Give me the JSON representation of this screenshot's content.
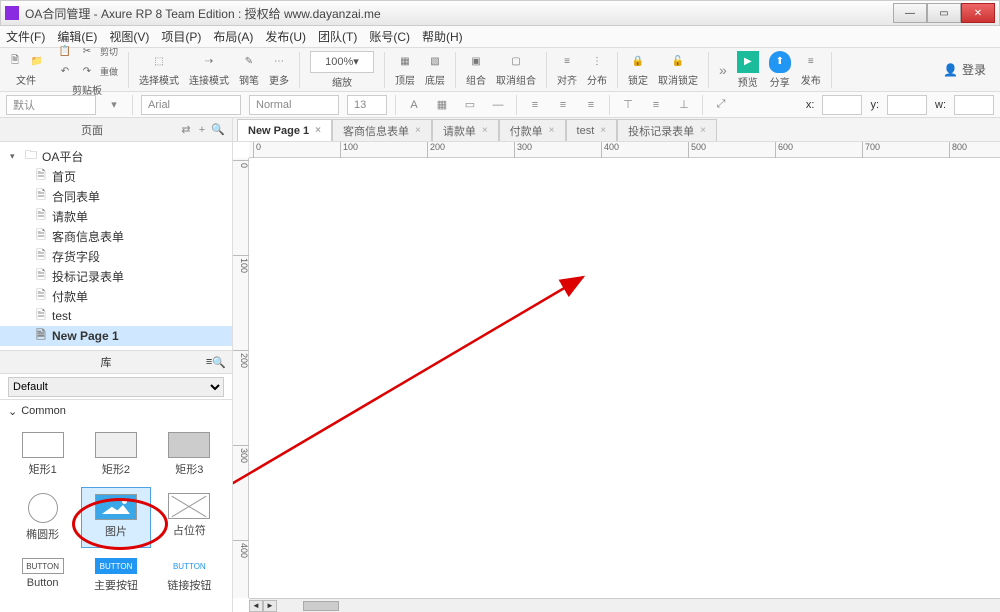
{
  "window": {
    "title": "OA合同管理 - Axure RP 8 Team Edition : 授权给 www.dayanzai.me"
  },
  "menus": [
    "文件(F)",
    "编辑(E)",
    "视图(V)",
    "项目(P)",
    "布局(A)",
    "发布(U)",
    "团队(T)",
    "账号(C)",
    "帮助(H)"
  ],
  "toolbar": {
    "file": "文件",
    "clipboard": "剪贴板",
    "cut": "剪切",
    "redo": "重做",
    "selmode": "选择模式",
    "conmode": "连接模式",
    "pen": "钢笔",
    "more": "更多",
    "zoom": "100%",
    "indent": "缩放",
    "top": "顶层",
    "bottom": "底层",
    "group": "组合",
    "ungroup": "取消组合",
    "align": "对齐",
    "dist": "分布",
    "lock": "锁定",
    "unlock": "取消锁定",
    "preview": "预览",
    "share": "分享",
    "publish": "发布",
    "login": "登录"
  },
  "stylebar": {
    "defaultStyle": "默认",
    "font": "Arial",
    "weight": "Normal",
    "size": "13",
    "xlabel": "x:",
    "ylabel": "y:",
    "wlabel": "w:"
  },
  "pagesPanel": {
    "title": "页面"
  },
  "tree": {
    "root": "OA平台",
    "items": [
      {
        "label": "首页"
      },
      {
        "label": "合同表单"
      },
      {
        "label": "请款单"
      },
      {
        "label": "客商信息表单"
      },
      {
        "label": "存货字段"
      },
      {
        "label": "投标记录表单"
      },
      {
        "label": "付款单"
      },
      {
        "label": "test"
      },
      {
        "label": "New Page 1",
        "selected": true
      }
    ]
  },
  "library": {
    "title": "库",
    "dropdown": "Default",
    "category": "Common",
    "items": [
      {
        "label": "矩形1",
        "shape": "rect1"
      },
      {
        "label": "矩形2",
        "shape": "rect2"
      },
      {
        "label": "矩形3",
        "shape": "rect3"
      },
      {
        "label": "椭圆形",
        "shape": "circle"
      },
      {
        "label": "图片",
        "shape": "image",
        "selected": true
      },
      {
        "label": "占位符",
        "shape": "placeholder"
      },
      {
        "label": "Button",
        "shape": "btn"
      },
      {
        "label": "主要按钮",
        "shape": "btnpri"
      },
      {
        "label": "链接按钮",
        "shape": "btnlink"
      }
    ],
    "btnText": "BUTTON"
  },
  "tabs": [
    {
      "label": "New Page 1",
      "active": true
    },
    {
      "label": "客商信息表单"
    },
    {
      "label": "请款单"
    },
    {
      "label": "付款单"
    },
    {
      "label": "test"
    },
    {
      "label": "投标记录表单"
    }
  ],
  "ruler": {
    "hticks": [
      0,
      100,
      200,
      300,
      400,
      500,
      600,
      700,
      800
    ],
    "vticks": [
      0,
      100,
      200,
      300,
      400
    ]
  }
}
